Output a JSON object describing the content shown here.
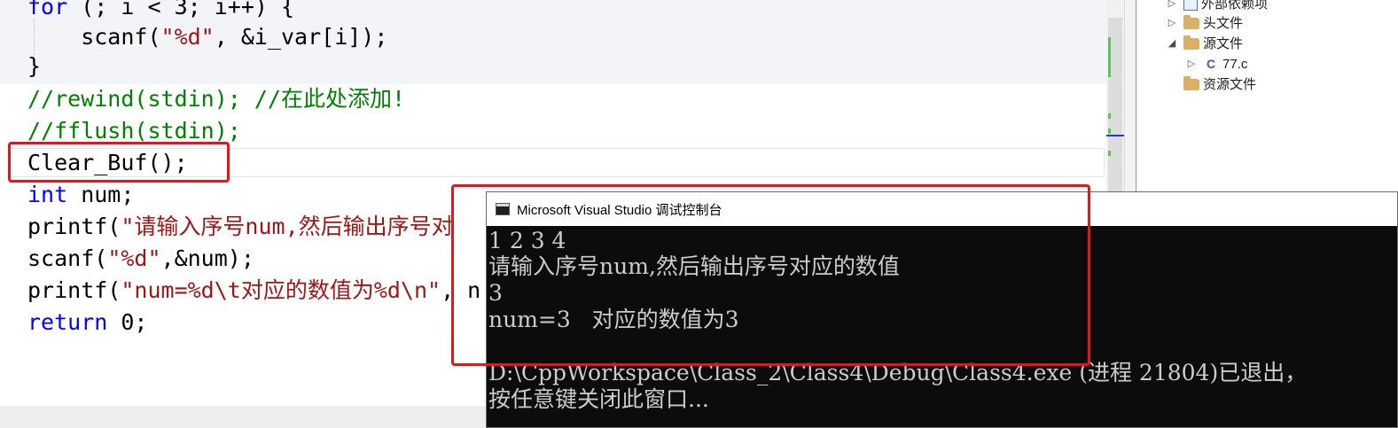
{
  "editor": {
    "lines": [
      {
        "segments": [
          {
            "cls": "kw",
            "text": "for"
          },
          {
            "cls": "",
            "text": " (; i < 3; i++) {"
          }
        ]
      },
      {
        "segments": [
          {
            "cls": "",
            "text": "    scanf("
          },
          {
            "cls": "str",
            "text": "\"%d\""
          },
          {
            "cls": "",
            "text": ", &i_var[i]);"
          }
        ]
      },
      {
        "segments": [
          {
            "cls": "",
            "text": "}"
          }
        ]
      },
      {
        "segments": [
          {
            "cls": "cmt",
            "text": "//rewind(stdin); //在此处添加!"
          }
        ]
      },
      {
        "segments": [
          {
            "cls": "cmt",
            "text": "//fflush(stdin);"
          }
        ]
      },
      {
        "segments": [
          {
            "cls": "",
            "text": "Clear_Buf();"
          }
        ]
      },
      {
        "segments": [
          {
            "cls": "kw",
            "text": "int"
          },
          {
            "cls": "",
            "text": " num;"
          }
        ]
      },
      {
        "segments": [
          {
            "cls": "",
            "text": "printf("
          },
          {
            "cls": "str",
            "text": "\"请输入序号num,然后输出序号对"
          }
        ]
      },
      {
        "segments": [
          {
            "cls": "",
            "text": "scanf("
          },
          {
            "cls": "str",
            "text": "\"%d\""
          },
          {
            "cls": "",
            "text": ",&num);"
          }
        ]
      },
      {
        "segments": [
          {
            "cls": "",
            "text": "printf("
          },
          {
            "cls": "str",
            "text": "\"num=%d\\t对应的数值为%d\\n\""
          },
          {
            "cls": "",
            "text": ", n"
          }
        ]
      },
      {
        "segments": [
          {
            "cls": "kw",
            "text": "return"
          },
          {
            "cls": "",
            "text": " 0;"
          }
        ]
      }
    ]
  },
  "solution_explorer": {
    "items": [
      {
        "label": "外部依赖项",
        "arrow": "▷",
        "icon": "dependencies-icon"
      },
      {
        "label": "头文件",
        "arrow": "▷",
        "icon": "folder-icon"
      },
      {
        "label": "源文件",
        "arrow": "◢",
        "icon": "folder-icon"
      },
      {
        "label": "77.c",
        "arrow": "▷",
        "icon": "c-file-icon",
        "glyph": "C"
      },
      {
        "label": "资源文件",
        "arrow": "",
        "icon": "folder-icon"
      }
    ]
  },
  "console": {
    "title": "Microsoft Visual Studio 调试控制台",
    "lines": [
      "1 2 3 4",
      "请输入序号num,然后输出序号对应的数值",
      "3",
      "num=3   对应的数值为3",
      "",
      "D:\\CppWorkspace\\Class_2\\Class4\\Debug\\Class4.exe (进程 21804)已退出，",
      "按任意键关闭此窗口..."
    ]
  },
  "colors": {
    "keyword": "#0000ff",
    "string": "#a31515",
    "comment": "#008000",
    "annotation": "#e8141d",
    "console_bg": "#0c0c0c",
    "console_text": "#cccccc"
  }
}
